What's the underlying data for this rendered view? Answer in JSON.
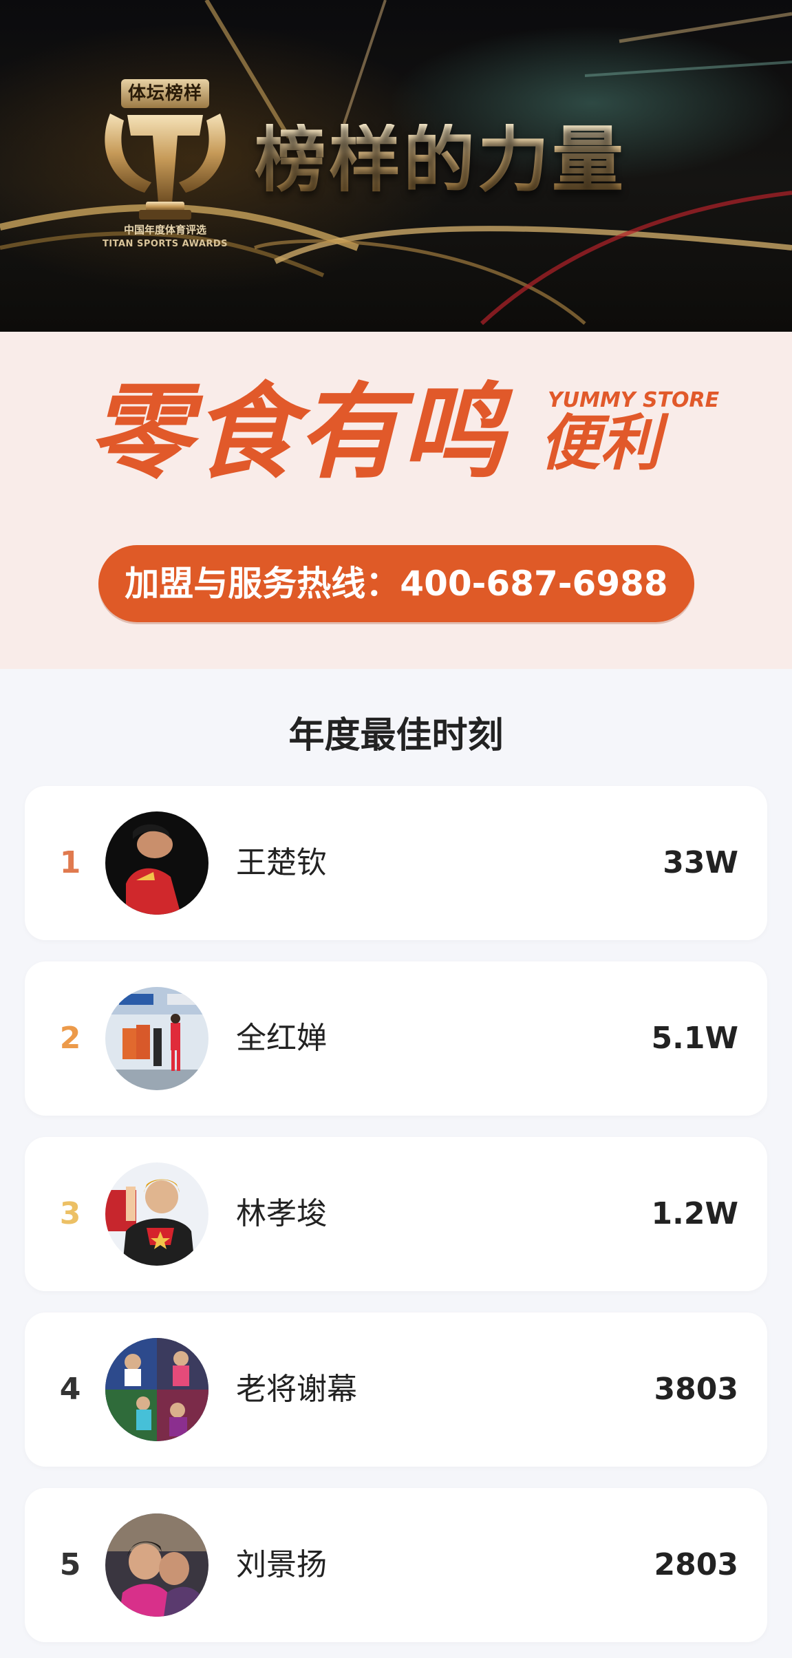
{
  "hero": {
    "badge_label": "体坛榜样",
    "award_cn": "中国年度体育评选",
    "award_en": "TITAN SPORTS AWARDS",
    "title": "榜样的力量"
  },
  "ad": {
    "brand": "零食有鸣",
    "brand_sub": "便利",
    "brand_en": "YUMMY STORE",
    "hotline": "加盟与服务热线：400-687-6988",
    "color": "#e1592a"
  },
  "ranking": {
    "title": "年度最佳时刻",
    "items": [
      {
        "rank": "1",
        "name": "王楚钦",
        "score": "33W",
        "rank_color": "#e07a4f"
      },
      {
        "rank": "2",
        "name": "全红婵",
        "score": "5.1W",
        "rank_color": "#ec9a4a"
      },
      {
        "rank": "3",
        "name": "林孝埈",
        "score": "1.2W",
        "rank_color": "#ecc065"
      },
      {
        "rank": "4",
        "name": "老将谢幕",
        "score": "3803",
        "rank_color": "#333333"
      },
      {
        "rank": "5",
        "name": "刘景扬",
        "score": "2803",
        "rank_color": "#333333"
      }
    ]
  }
}
